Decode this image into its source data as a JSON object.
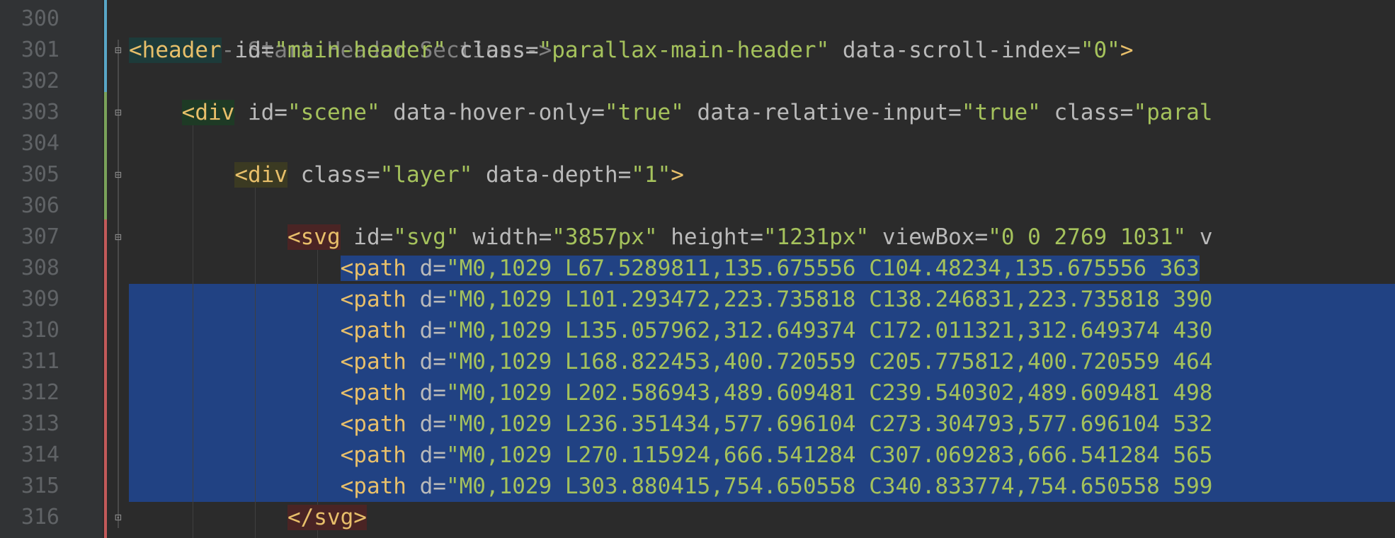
{
  "editor": {
    "line_numbers": [
      "300",
      "301",
      "302",
      "303",
      "304",
      "305",
      "306",
      "307",
      "308",
      "309",
      "310",
      "311",
      "312",
      "313",
      "314",
      "315",
      "316"
    ],
    "lines": {
      "l300": {
        "comment": "<!-- Start Header Section-->"
      },
      "l301": {
        "open": "<header",
        "a1": " id=",
        "v1": "\"main-header\"",
        "a2": " class=",
        "v2": "\"parallax-main-header\"",
        "a3": " data-scroll-index=",
        "v3": "\"0\"",
        "close": ">"
      },
      "l303": {
        "open": "<div",
        "a1": " id=",
        "v1": "\"scene\"",
        "a2": " data-hover-only=",
        "v2": "\"true\"",
        "a3": " data-relative-input=",
        "v3": "\"true\"",
        "a4": " class=",
        "v4": "\"paral"
      },
      "l305": {
        "open": "<div",
        "a1": " class=",
        "v1": "\"layer\"",
        "a2": " data-depth=",
        "v2": "\"1\"",
        "close": ">"
      },
      "l307": {
        "open": "<svg",
        "a1": " id=",
        "v1": "\"svg\"",
        "a2": " width=",
        "v2": "\"3857px\"",
        "a3": " height=",
        "v3": "\"1231px\"",
        "a4": " viewBox=",
        "v4": "\"0 0 2769 1031\"",
        "tail": " v"
      },
      "paths": [
        {
          "open": "<path",
          "a": " d=",
          "v": "\"M0,1029 L67.5289811,135.675556 C104.48234,135.675556 363"
        },
        {
          "open": "<path",
          "a": " d=",
          "v": "\"M0,1029 L101.293472,223.735818 C138.246831,223.735818 390"
        },
        {
          "open": "<path",
          "a": " d=",
          "v": "\"M0,1029 L135.057962,312.649374 C172.011321,312.649374 430"
        },
        {
          "open": "<path",
          "a": " d=",
          "v": "\"M0,1029 L168.822453,400.720559 C205.775812,400.720559 464"
        },
        {
          "open": "<path",
          "a": " d=",
          "v": "\"M0,1029 L202.586943,489.609481 C239.540302,489.609481 498"
        },
        {
          "open": "<path",
          "a": " d=",
          "v": "\"M0,1029 L236.351434,577.696104 C273.304793,577.696104 532"
        },
        {
          "open": "<path",
          "a": " d=",
          "v": "\"M0,1029 L270.115924,666.541284 C307.069283,666.541284 565"
        },
        {
          "open": "<path",
          "a": " d=",
          "v": "\"M0,1029 L303.880415,754.650558 C340.833774,754.650558 599"
        }
      ],
      "l316": {
        "close_tag": "</svg>"
      }
    },
    "colors": {
      "background": "#2b2b2b",
      "gutter": "#313335",
      "selection": "#214283",
      "tag": "#e8bf6a",
      "attribute": "#bababa",
      "value": "#a5c25c",
      "comment": "#808080"
    }
  }
}
